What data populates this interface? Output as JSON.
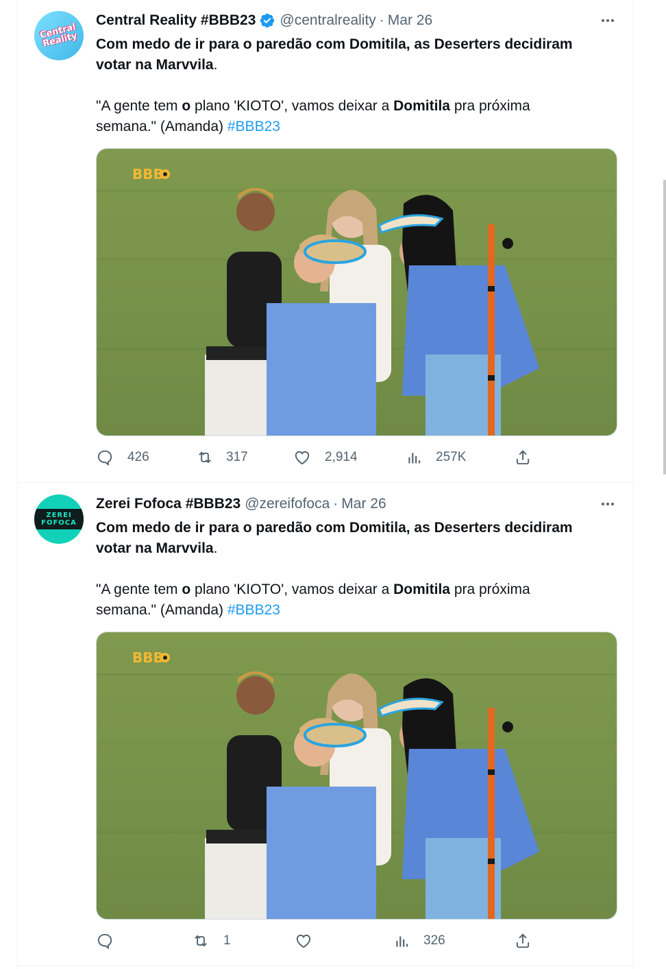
{
  "tweets": [
    {
      "name": "Central Reality #BBB23",
      "verified": true,
      "handle": "@centralreality",
      "separator": "·",
      "date": "Mar 26",
      "avatar_text": "Central Reality",
      "headline_1": "Com medo de ir para o paredão com Domitila, as Deserters decidiram",
      "headline_2": "votar na Marvvila",
      "headline_period": ".",
      "quote_part1": "\"A gente tem ",
      "quote_bold1": "o",
      "quote_part2": " plano 'KIOTO', vamos deixar a ",
      "quote_bold2": "Domitila",
      "quote_part3": " pra próxima",
      "quote_line2": "semana.\" (Amanda) ",
      "hashtag": "#BBB23",
      "media_watermark": "BBB",
      "reply_count": "426",
      "retweet_count": "317",
      "like_count": "2,914",
      "view_count": "257K"
    },
    {
      "name": "Zerei Fofoca #BBB23",
      "verified": false,
      "handle": "@zereifofoca",
      "separator": "·",
      "date": "Mar 26",
      "avatar_text": "ZEREI FOFOCA",
      "headline_1": "Com medo de ir para o paredão com Domitila, as Deserters decidiram",
      "headline_2": "votar na Marvvila",
      "headline_period": ".",
      "quote_part1": "\"A gente tem ",
      "quote_bold1": "o",
      "quote_part2": " plano 'KIOTO', vamos deixar a ",
      "quote_bold2": "Domitila",
      "quote_part3": " pra próxima",
      "quote_line2": "semana.\" (Amanda) ",
      "hashtag": "#BBB23",
      "media_watermark": "BBB",
      "reply_count": "",
      "retweet_count": "1",
      "like_count": "",
      "view_count": "326"
    }
  ],
  "icons": {
    "reply": "reply-icon",
    "retweet": "retweet-icon",
    "like": "heart-icon",
    "views": "views-icon",
    "share": "share-icon",
    "more": "more-icon",
    "verified": "verified-badge-icon"
  },
  "colors": {
    "text": "#0f1419",
    "secondary": "#536471",
    "hashtag": "#1d9bf0",
    "verified": "#1d9bf0"
  }
}
